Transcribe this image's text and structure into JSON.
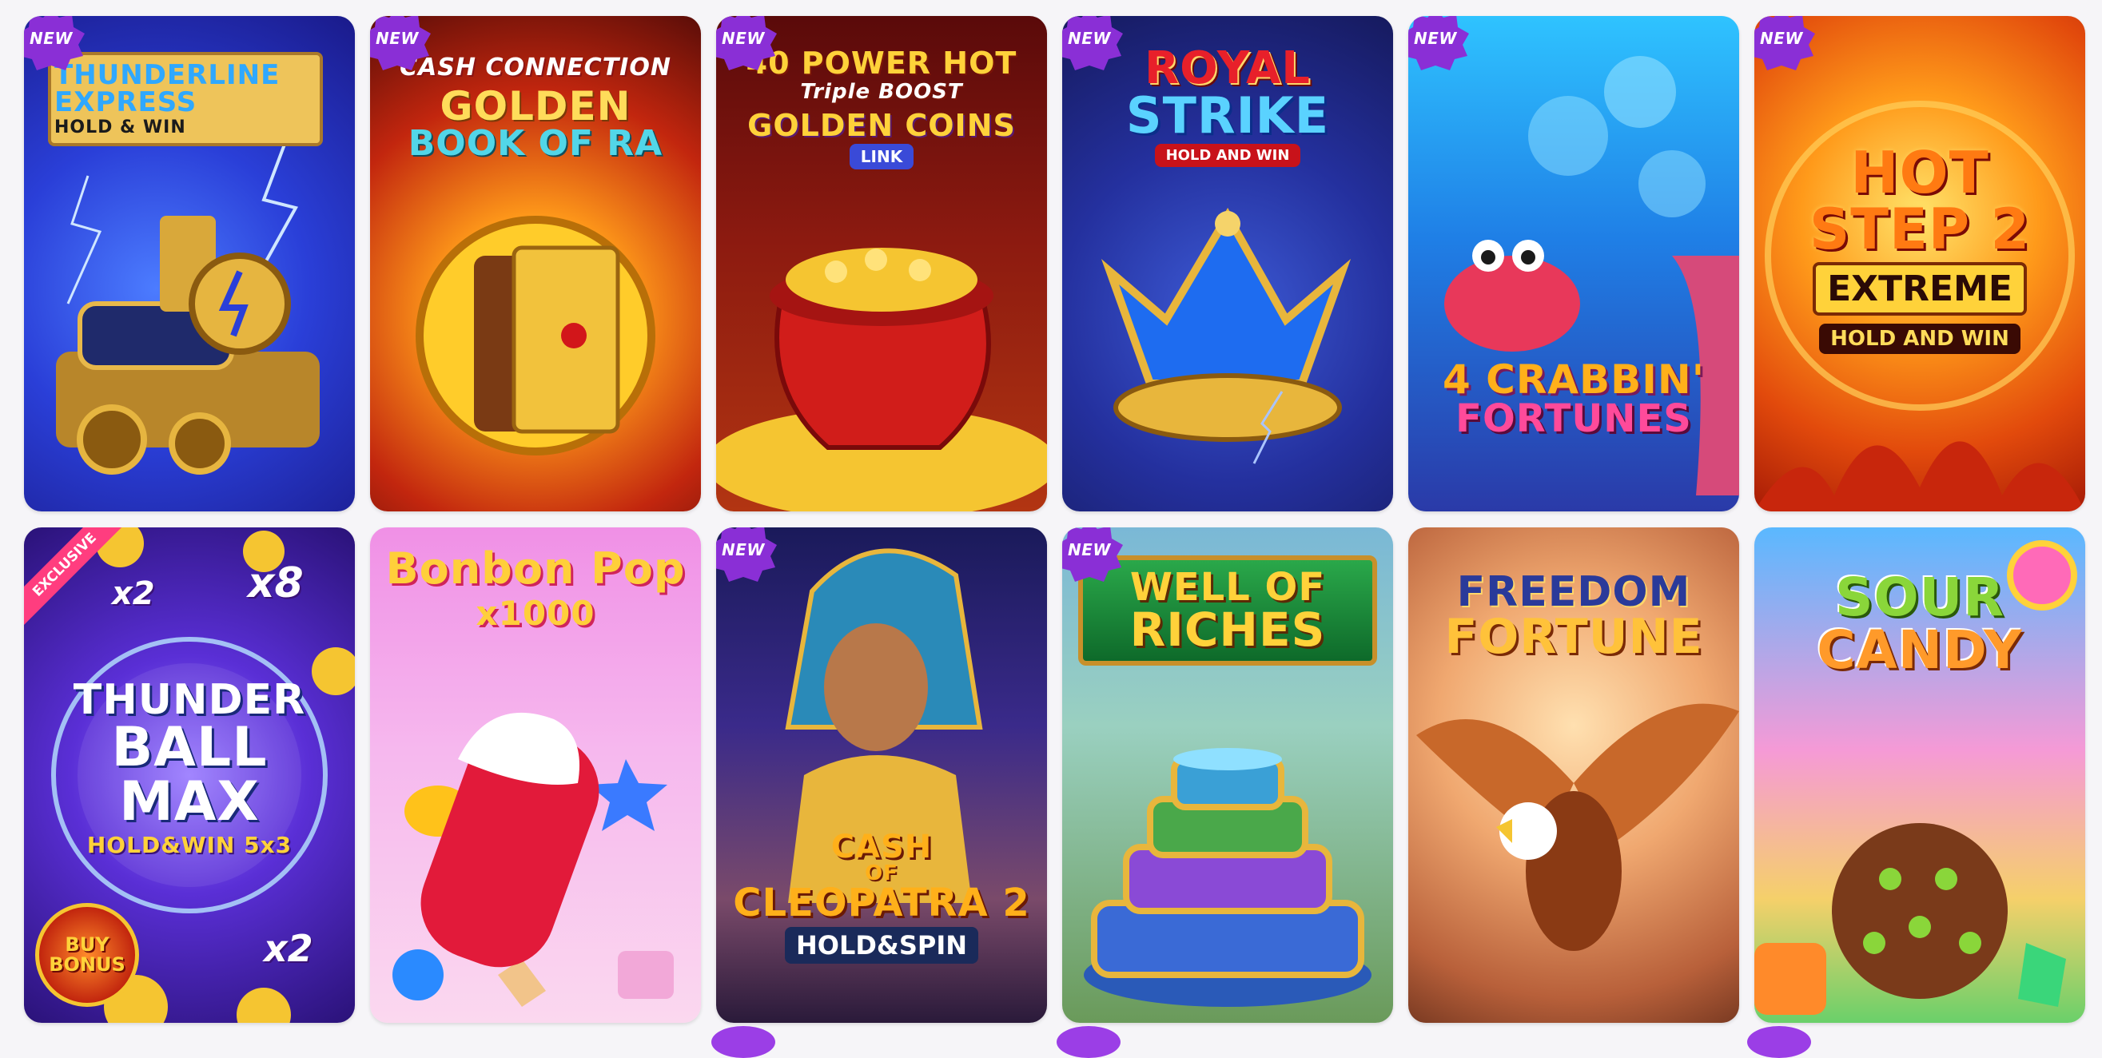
{
  "badges": {
    "new": "NEW",
    "exclusive": "EXCLUSIVE"
  },
  "games": [
    {
      "id": "thunderline",
      "title_lines": [
        "THUNDERLINE",
        "EXPRESS"
      ],
      "subtitle": "HOLD & WIN",
      "badge": "NEW"
    },
    {
      "id": "golden-book",
      "title_lines": [
        "CASH CONNECTION",
        "GOLDEN",
        "BOOK OF RA"
      ],
      "subtitle": "",
      "badge": "NEW"
    },
    {
      "id": "power-hot",
      "title_lines": [
        "40 POWER HOT",
        "Triple BOOST",
        "GOLDEN COINS"
      ],
      "subtitle": "LINK",
      "badge": "NEW"
    },
    {
      "id": "royal-strike",
      "title_lines": [
        "ROYAL",
        "STRIKE"
      ],
      "subtitle": "HOLD AND WIN",
      "badge": "NEW"
    },
    {
      "id": "crabbin",
      "title_lines": [
        "4 CRABBIN'",
        "FORTUNES"
      ],
      "subtitle": "",
      "badge": "NEW"
    },
    {
      "id": "hot-step",
      "title_lines": [
        "HOT",
        "STEP 2",
        "EXTREME"
      ],
      "subtitle": "HOLD AND WIN",
      "badge": "NEW"
    },
    {
      "id": "thunder-ball",
      "title_lines": [
        "THUNDER",
        "BALL",
        "MAX"
      ],
      "subtitle": "HOLD&WIN 5x3",
      "badge": "EXCLUSIVE",
      "extras": [
        "x2",
        "x8",
        "x2",
        "BUY BONUS"
      ]
    },
    {
      "id": "bonbon-pop",
      "title_lines": [
        "Bonbon Pop",
        "x1000"
      ],
      "subtitle": "",
      "badge": ""
    },
    {
      "id": "cleopatra",
      "title_lines": [
        "CASH",
        "OF",
        "CLEOPATRA 2"
      ],
      "subtitle": "HOLD&SPIN",
      "badge": "NEW"
    },
    {
      "id": "well-riches",
      "title_lines": [
        "WELL OF",
        "RICHES"
      ],
      "subtitle": "",
      "badge": "NEW"
    },
    {
      "id": "freedom",
      "title_lines": [
        "FREEDOM",
        "FORTUNE"
      ],
      "subtitle": "",
      "badge": ""
    },
    {
      "id": "sour-candy",
      "title_lines": [
        "SOUR",
        "CANDY"
      ],
      "subtitle": "",
      "badge": ""
    }
  ]
}
